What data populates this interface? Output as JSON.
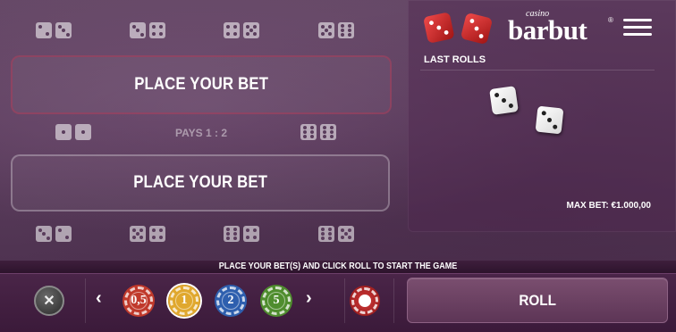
{
  "header": {
    "brand_small": "casino",
    "brand_name": "barbut",
    "brand_mark": "®",
    "menu_icon": "hamburger-menu-icon"
  },
  "table": {
    "top_bet_label": "PLACE YOUR BET",
    "bottom_bet_label": "PLACE YOUR BET",
    "pays_label": "PAYS 1 : 2",
    "top_dice_pairs": [
      [
        2,
        3
      ],
      [
        3,
        4
      ],
      [
        4,
        5
      ],
      [
        5,
        6
      ]
    ],
    "middle_left_pair": [
      1,
      1
    ],
    "middle_right_pair": [
      6,
      6
    ],
    "bottom_dice_pairs": [
      [
        3,
        2
      ],
      [
        5,
        4
      ],
      [
        6,
        4
      ],
      [
        6,
        5
      ]
    ]
  },
  "side_panel": {
    "last_rolls_label": "LAST ROLLS",
    "last_roll_dice": [
      3,
      3
    ],
    "max_bet_label": "MAX BET: €1.000,00"
  },
  "message_bar": {
    "text": "PLACE YOUR BET(S) AND CLICK ROLL TO START THE GAME"
  },
  "controls": {
    "clear_icon": "clear-bets-icon",
    "prev_arrow": "‹",
    "next_arrow": "›",
    "chips": [
      {
        "label": "0,5",
        "color": "#c0392b"
      },
      {
        "label": "1",
        "color": "#e0a82e"
      },
      {
        "label": "2",
        "color": "#2e5fae"
      },
      {
        "label": "5",
        "color": "#4f8d2e"
      }
    ],
    "selected_chip": "1",
    "double_icon": "double-bet-icon",
    "roll_label": "ROLL"
  },
  "colors": {
    "felt": "#5d3f5f",
    "bar": "#3b1a3a",
    "roll_button": "#6a4262",
    "top_bet_border": "#aa3c5a"
  }
}
